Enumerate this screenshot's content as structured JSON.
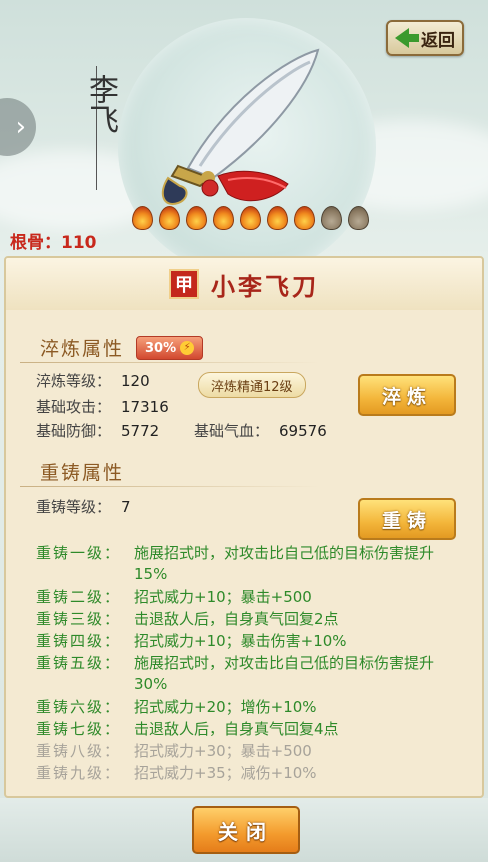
{
  "header": {
    "back_label": "返回",
    "calligraphy": "李飞",
    "root_label": "根骨：110",
    "flames_lit": 7,
    "flames_total": 9
  },
  "panel": {
    "grade_char": "甲",
    "title": "小李飞刀",
    "temper": {
      "section_title": "淬炼属性",
      "percent_badge": "30%",
      "level_label": "淬炼等级：",
      "level_value": "120",
      "mastery_badge": "淬炼精通12级",
      "attack_label": "基础攻击：",
      "attack_value": "17316",
      "defense_label": "基础防御：",
      "defense_value": "5772",
      "qi_label": "基础气血：",
      "qi_value": "69576",
      "button": "淬炼"
    },
    "recast": {
      "section_title": "重铸属性",
      "level_label": "重铸等级：",
      "level_value": "7",
      "button": "重铸",
      "levels": [
        {
          "label": "重铸一级：",
          "desc": "施展招式时，对攻击比自己低的目标伤害提升15%"
        },
        {
          "label": "重铸二级：",
          "desc": "招式威力+10；暴击+500"
        },
        {
          "label": "重铸三级：",
          "desc": "击退敌人后，自身真气回复2点"
        },
        {
          "label": "重铸四级：",
          "desc": "招式威力+10；暴击伤害+10%"
        },
        {
          "label": "重铸五级：",
          "desc": "施展招式时，对攻击比自己低的目标伤害提升30%"
        },
        {
          "label": "重铸六级：",
          "desc": "招式威力+20；增伤+10%"
        },
        {
          "label": "重铸七级：",
          "desc": "击退敌人后，自身真气回复4点"
        },
        {
          "label": "重铸八级：",
          "desc": "招式威力+30；暴击+500"
        },
        {
          "label": "重铸九级：",
          "desc": "招式威力+35；减伤+10%"
        }
      ]
    }
  },
  "footer": {
    "close_label": "关闭"
  },
  "colors": {
    "active_text": "#2e8a2a",
    "inactive_text": "#a7a39a",
    "title_red": "#a8261a"
  }
}
